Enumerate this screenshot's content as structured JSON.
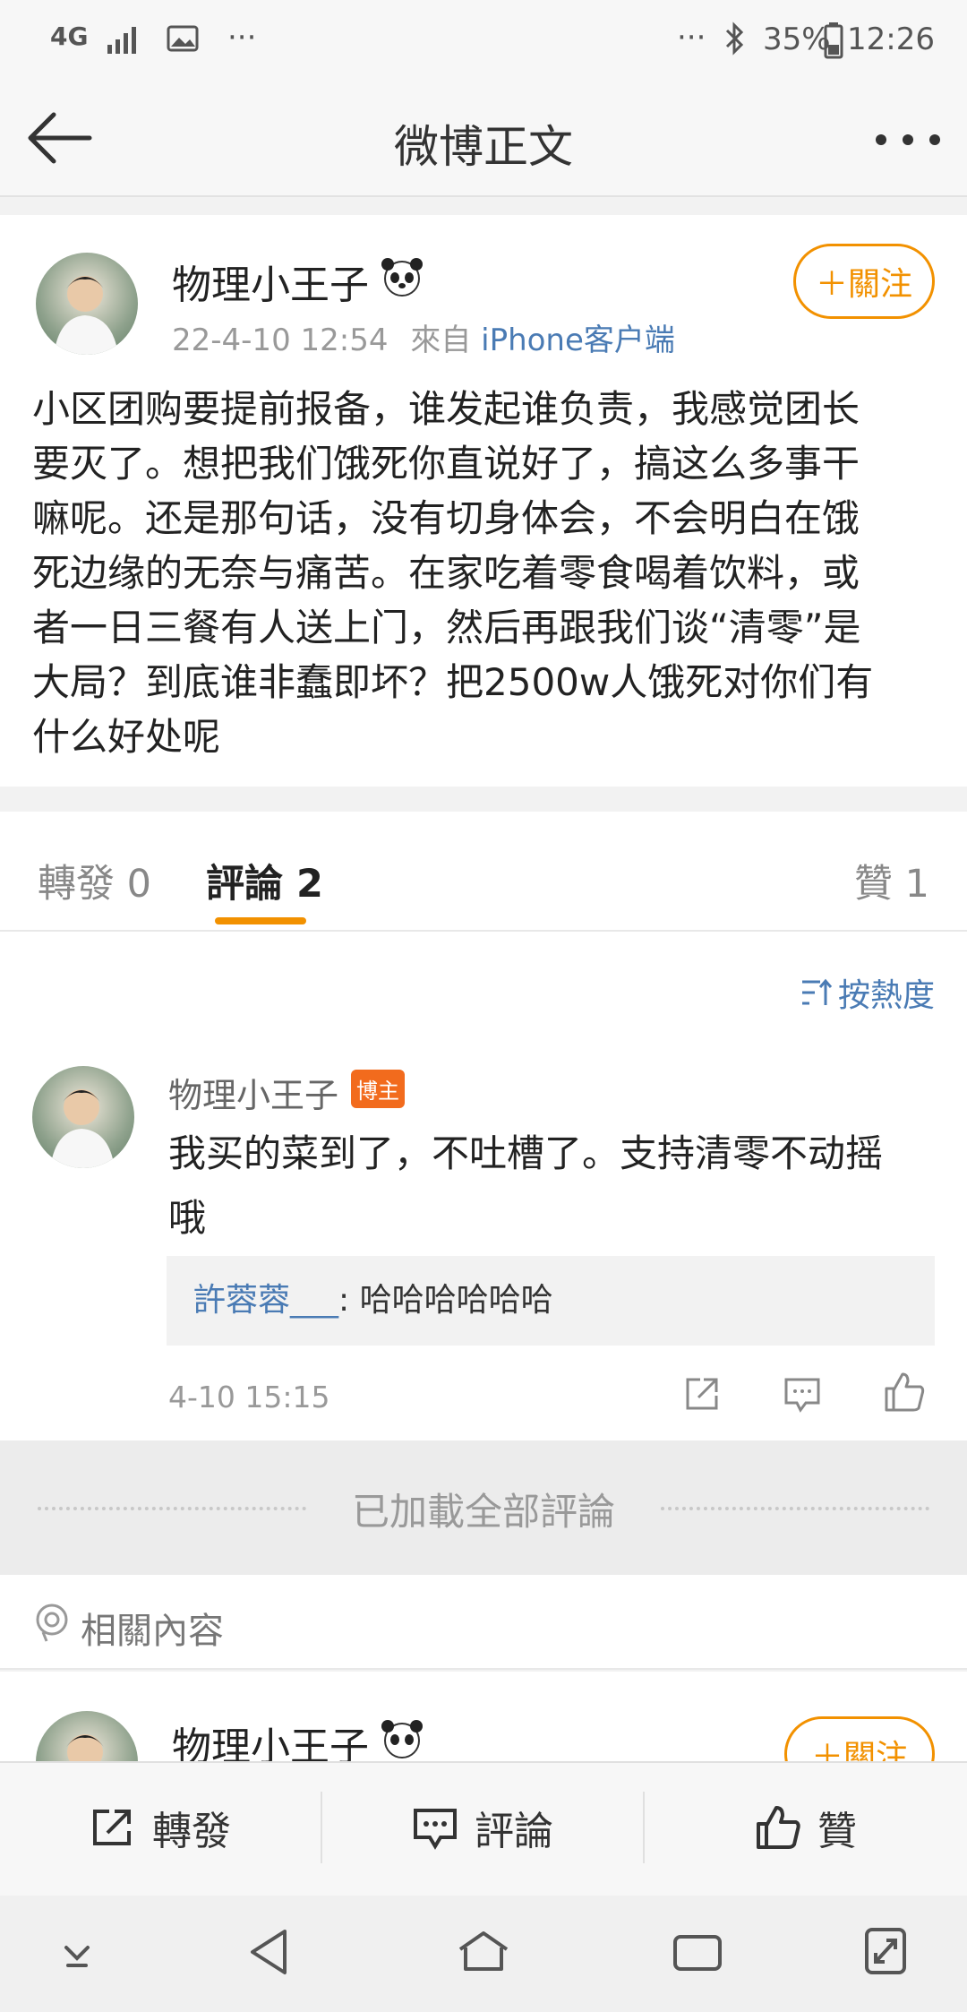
{
  "status": {
    "network": "4G",
    "more": "···",
    "battery": "35%",
    "time": "12:26"
  },
  "nav": {
    "title": "微博正文"
  },
  "post": {
    "author": "物理小王子",
    "date": "22-4-10 12:54",
    "source_prefix": "來自",
    "source": "iPhone客户端",
    "follow_label": "＋關注",
    "lines": [
      "小区团购要提前报备，谁发起谁负责，我感觉团长",
      "要灭了。想把我们饿死你直说好了，搞这么多事干",
      "嘛呢。还是那句话，没有切身体会，不会明白在饿",
      "死边缘的无奈与痛苦。在家吃着零食喝着饮料，或",
      "者一日三餐有人送上门，然后再跟我们谈“清零”是",
      "大局？到底谁非蠢即坏？把2500w人饿死对你们有",
      "什么好处呢"
    ]
  },
  "tabs": {
    "repost": "轉發 0",
    "comments": "評論 2",
    "likes": "贊 1"
  },
  "sort": {
    "label": "按熱度"
  },
  "comment": {
    "author": "物理小王子",
    "badge": "博主",
    "text_line1": "我买的菜到了，不吐槽了。支持清零不动摇",
    "text_line2": "哦",
    "reply_user": "許蓉蓉___",
    "reply_text": ": 哈哈哈哈哈哈",
    "time": "4-10 15:15"
  },
  "loaded_all": "已加載全部評論",
  "related": {
    "label": "相關內容",
    "author": "物理小王子",
    "follow_label": "＋關注"
  },
  "toolbar": {
    "repost": "轉發",
    "comment": "評論",
    "like": "贊"
  },
  "colors": {
    "accent": "#f29100",
    "link": "#4a7bb4",
    "badge": "#f26b1d"
  }
}
